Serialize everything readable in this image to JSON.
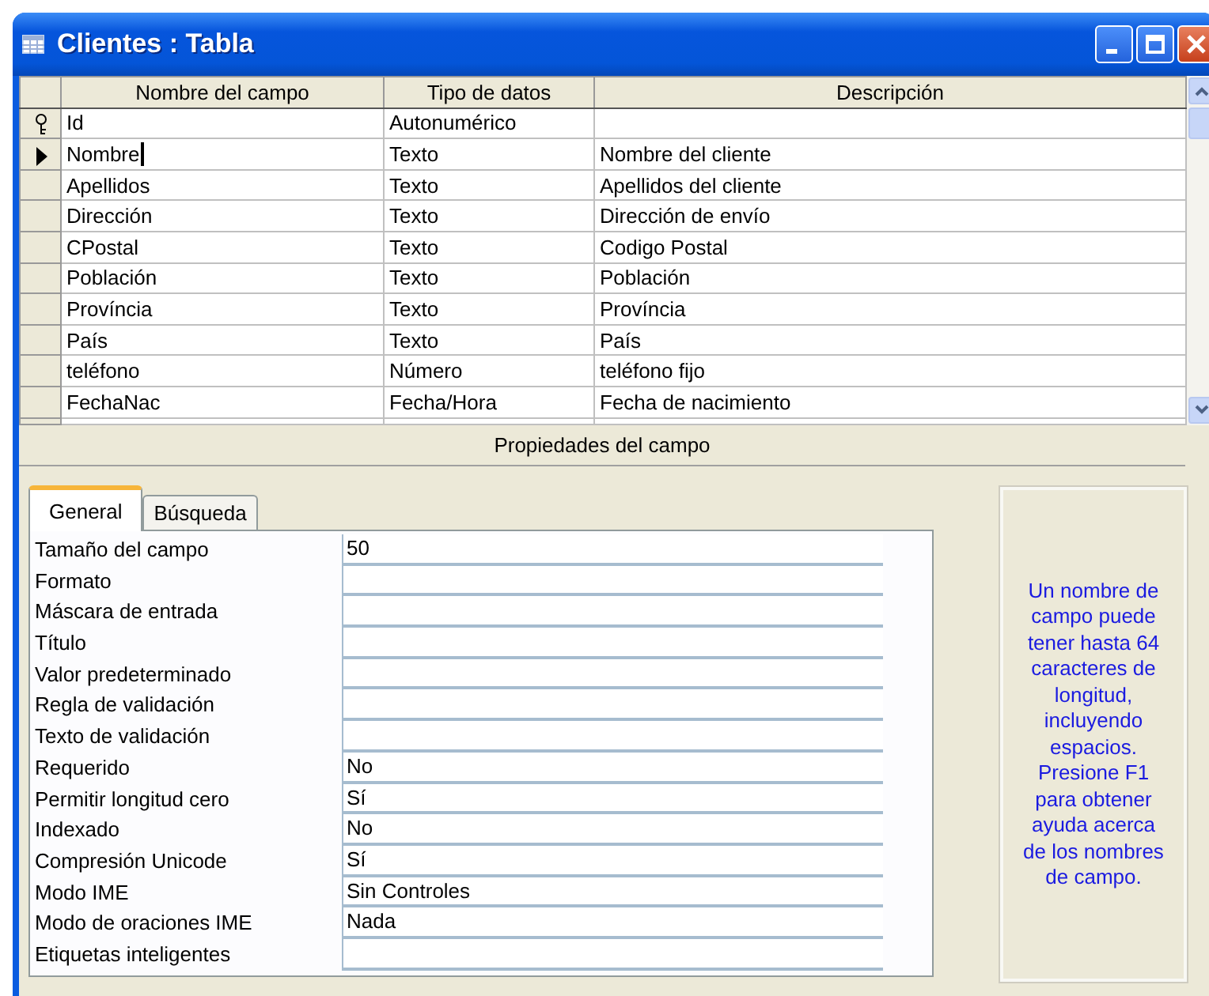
{
  "window": {
    "title": "Clientes : Tabla"
  },
  "grid": {
    "columns": [
      "Nombre del campo",
      "Tipo de datos",
      "Descripción"
    ],
    "rows": [
      {
        "name": "Id",
        "type": "Autonumérico",
        "description": "",
        "primary_key": true,
        "selected": false
      },
      {
        "name": "Nombre",
        "type": "Texto",
        "description": "Nombre del cliente",
        "primary_key": false,
        "selected": true
      },
      {
        "name": "Apellidos",
        "type": "Texto",
        "description": "Apellidos del cliente",
        "primary_key": false,
        "selected": false
      },
      {
        "name": "Dirección",
        "type": "Texto",
        "description": "Dirección de envío",
        "primary_key": false,
        "selected": false
      },
      {
        "name": "CPostal",
        "type": "Texto",
        "description": "Codigo Postal",
        "primary_key": false,
        "selected": false
      },
      {
        "name": "Población",
        "type": "Texto",
        "description": "Población",
        "primary_key": false,
        "selected": false
      },
      {
        "name": "Província",
        "type": "Texto",
        "description": "Província",
        "primary_key": false,
        "selected": false
      },
      {
        "name": "País",
        "type": "Texto",
        "description": "País",
        "primary_key": false,
        "selected": false
      },
      {
        "name": "teléfono",
        "type": "Número",
        "description": "teléfono fijo",
        "primary_key": false,
        "selected": false
      },
      {
        "name": "FechaNac",
        "type": "Fecha/Hora",
        "description": "Fecha de nacimiento",
        "primary_key": false,
        "selected": false
      }
    ]
  },
  "properties": {
    "title": "Propiedades del campo",
    "tabs": [
      {
        "label": "General",
        "selected": true
      },
      {
        "label": "Búsqueda",
        "selected": false
      }
    ],
    "rows": [
      {
        "label": "Tamaño del campo",
        "value": "50"
      },
      {
        "label": "Formato"
      },
      {
        "label": "Máscara de entrada"
      },
      {
        "label": "Título"
      },
      {
        "label": "Valor predeterminado"
      },
      {
        "label": "Regla de validación"
      },
      {
        "label": "Texto de validación"
      },
      {
        "label": "Requerido",
        "value": "No"
      },
      {
        "label": "Permitir longitud cero",
        "value": "Sí"
      },
      {
        "label": "Indexado",
        "value": "No"
      },
      {
        "label": "Compresión Unicode",
        "value": "Sí"
      },
      {
        "label": "Modo IME",
        "value": "Sin Controles"
      },
      {
        "label": "Modo de oraciones IME",
        "value": "Nada"
      },
      {
        "label": "Etiquetas inteligentes"
      }
    ],
    "help": "Un nombre de campo puede tener hasta 64 caracteres de longitud, incluyendo espacios. Presione F1 para obtener ayuda acerca de los nombres de campo."
  }
}
